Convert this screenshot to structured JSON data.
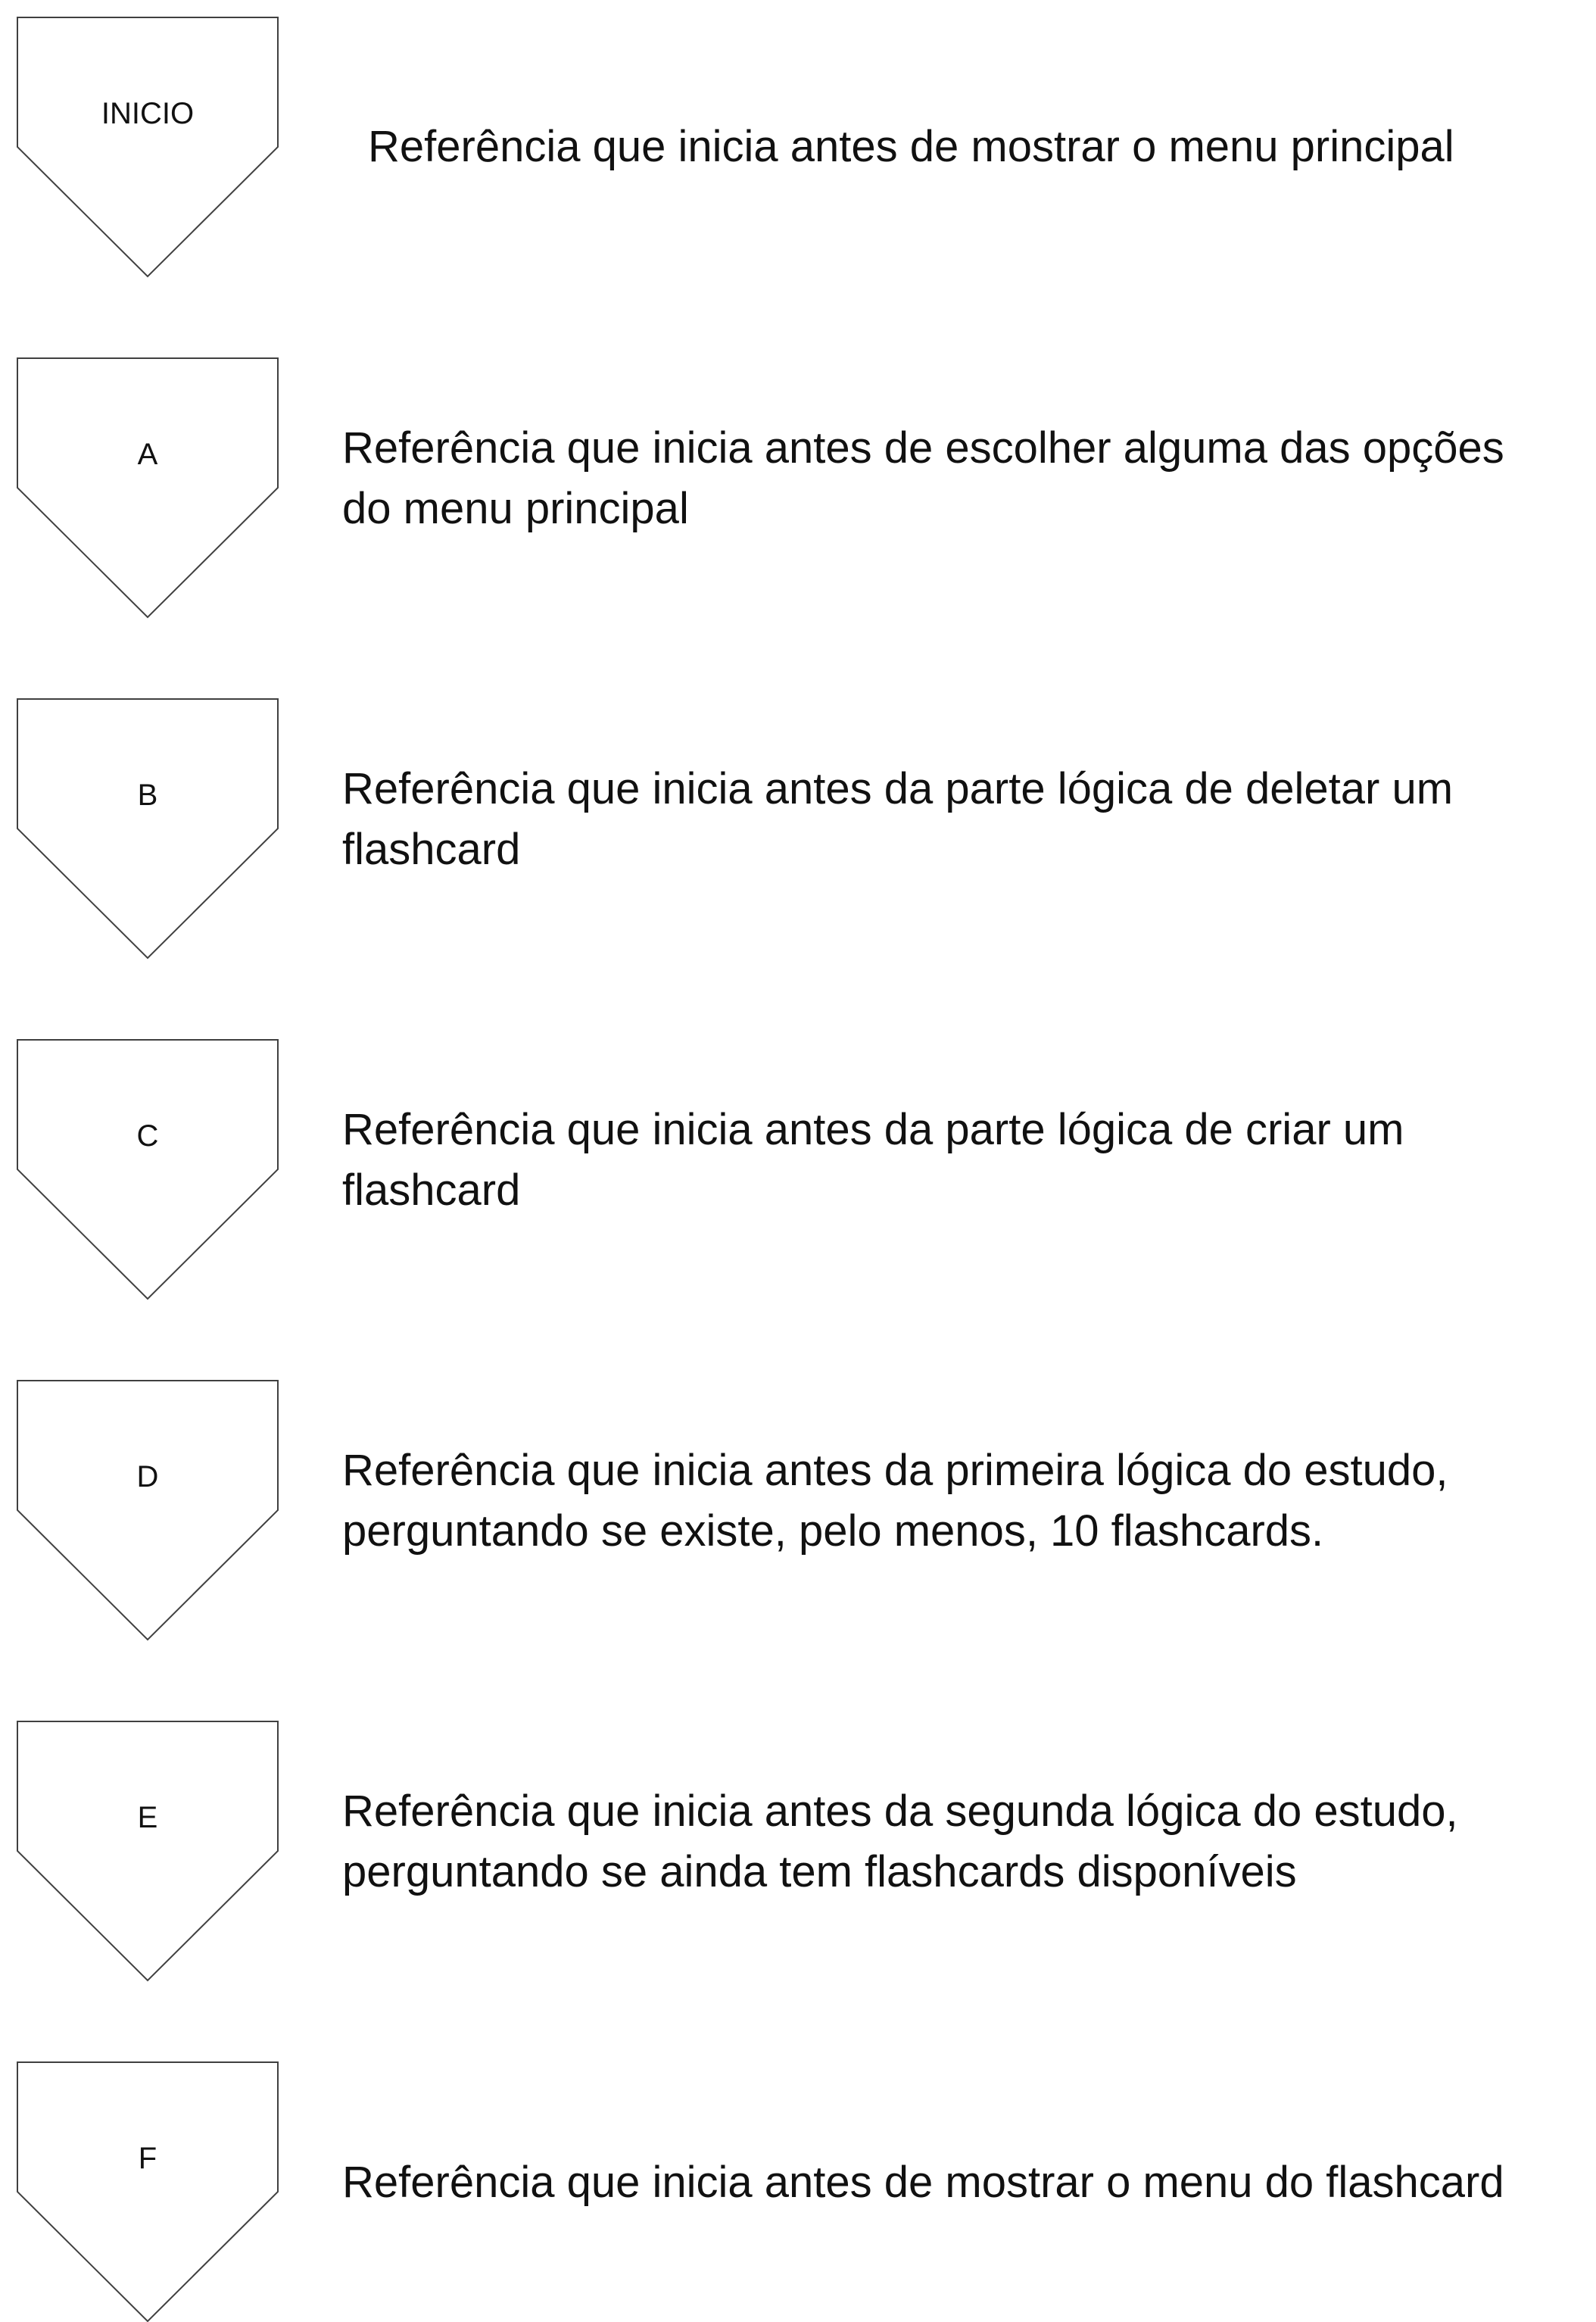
{
  "colors": {
    "shape_stroke": "#404040",
    "shape_fill": "#ffffff",
    "text": "#111111"
  },
  "connectors": [
    {
      "label": "INICIO",
      "lines": [
        "Referência que inicia antes de mostrar o menu principal"
      ]
    },
    {
      "label": "A",
      "lines": [
        "Referência que inicia antes de escolher alguma das opções",
        "do menu principal"
      ]
    },
    {
      "label": "B",
      "lines": [
        "Referência que inicia antes da parte lógica de deletar um",
        "flashcard"
      ]
    },
    {
      "label": "C",
      "lines": [
        "Referência que inicia antes da parte lógica de criar um",
        "flashcard"
      ]
    },
    {
      "label": "D",
      "lines": [
        "Referência que inicia antes da primeira lógica do estudo,",
        "perguntando se existe, pelo menos, 10 flashcards."
      ]
    },
    {
      "label": "E",
      "lines": [
        "Referência que inicia antes da segunda lógica do estudo,",
        "perguntando se ainda tem flashcards disponíveis"
      ]
    },
    {
      "label": "F",
      "lines": [
        "Referência que inicia antes de mostrar o menu do flashcard"
      ]
    }
  ]
}
